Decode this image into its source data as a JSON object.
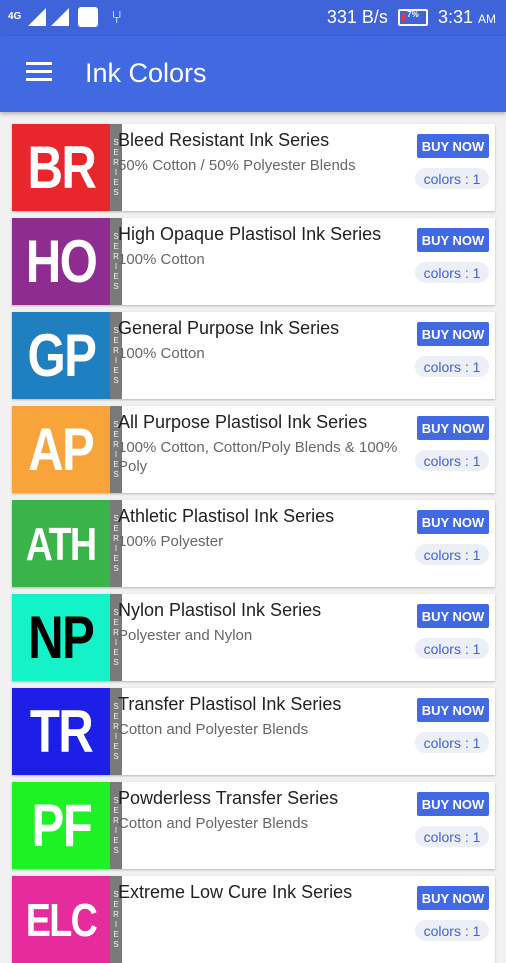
{
  "status_bar": {
    "network": "4G",
    "speed": "331 B/s",
    "battery": "7%",
    "time": "3:31",
    "ampm": "AM",
    "icons": [
      "signal-icon",
      "signal-icon",
      "notification-icon",
      "usb-icon",
      "battery-icon"
    ]
  },
  "app_bar": {
    "menu_icon": "hamburger-icon",
    "title": "Ink Colors"
  },
  "series_label": [
    "S",
    "E",
    "R",
    "I",
    "E",
    "S"
  ],
  "items": [
    {
      "abbr": "BR",
      "title": "Bleed Resistant Ink Series",
      "subtitle": "50% Cotton / 50% Polyester Blends",
      "buy": "BUY NOW",
      "colors": "colors : 1",
      "bg": "#e8262c",
      "fg": "#ffffff"
    },
    {
      "abbr": "HO",
      "title": "High Opaque Plastisol Ink Series",
      "subtitle": "100% Cotton",
      "buy": "BUY NOW",
      "colors": "colors : 1",
      "bg": "#8e2d8f",
      "fg": "#ffffff"
    },
    {
      "abbr": "GP",
      "title": "General Purpose Ink Series",
      "subtitle": "100% Cotton",
      "buy": "BUY NOW",
      "colors": "colors : 1",
      "bg": "#1f7fbf",
      "fg": "#ffffff"
    },
    {
      "abbr": "AP",
      "title": "All Purpose Plastisol Ink Series",
      "subtitle": "100% Cotton, Cotton/Poly Blends & 100% Poly",
      "buy": "BUY NOW",
      "colors": "colors : 1",
      "bg": "#f8a43a",
      "fg": "#ffffff"
    },
    {
      "abbr": "ATH",
      "title": "Athletic Plastisol Ink Series",
      "subtitle": "100% Polyester",
      "buy": "BUY NOW",
      "colors": "colors : 1",
      "bg": "#3ab34a",
      "fg": "#ffffff"
    },
    {
      "abbr": "NP",
      "title": "Nylon Plastisol Ink Series",
      "subtitle": "Polyester and Nylon",
      "buy": "BUY NOW",
      "colors": "colors : 1",
      "bg": "#14f2c8",
      "fg": "#000000"
    },
    {
      "abbr": "TR",
      "title": "Transfer Plastisol Ink Series",
      "subtitle": "Cotton and Polyester Blends",
      "buy": "BUY NOW",
      "colors": "colors : 1",
      "bg": "#1d1fe6",
      "fg": "#ffffff"
    },
    {
      "abbr": "PF",
      "title": "Powderless Transfer Series",
      "subtitle": "Cotton and Polyester Blends",
      "buy": "BUY NOW",
      "colors": "colors : 1",
      "bg": "#1df226",
      "fg": "#ffffff"
    },
    {
      "abbr": "ELC",
      "title": "Extreme Low Cure Ink Series",
      "subtitle": "",
      "buy": "BUY NOW",
      "colors": "colors : 1",
      "bg": "#e62b9c",
      "fg": "#ffffff"
    }
  ]
}
